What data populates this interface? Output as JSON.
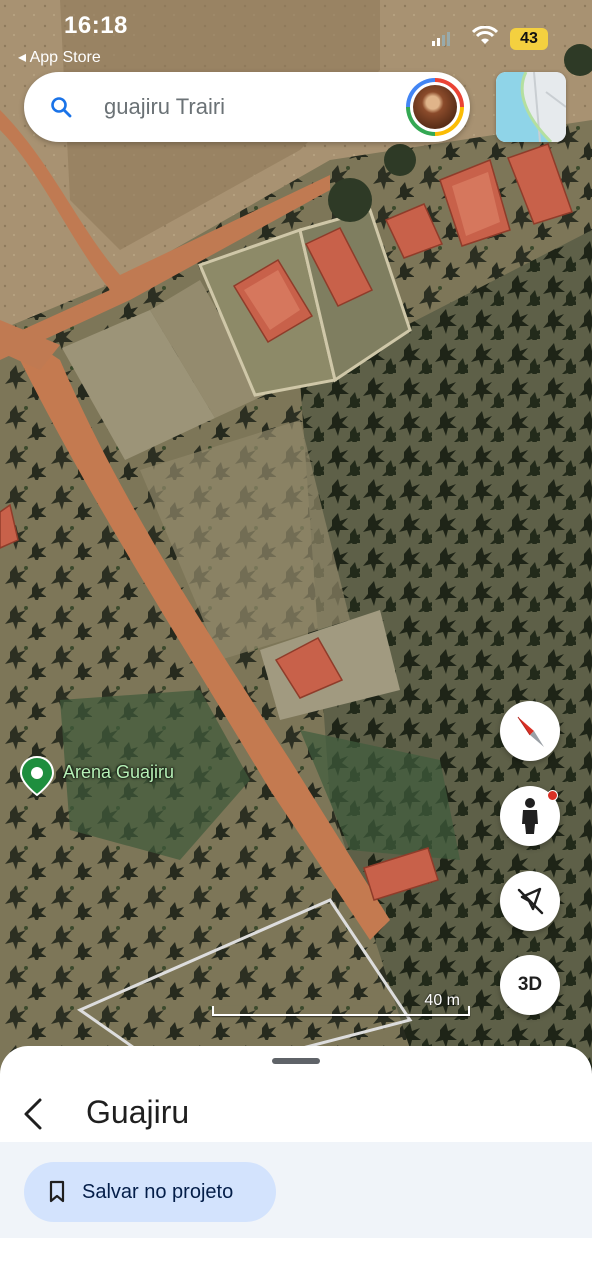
{
  "status_bar": {
    "time": "16:18",
    "back_app": "App Store",
    "battery": "43"
  },
  "search": {
    "query": "guajiru Trairi",
    "icon": "search-icon"
  },
  "map": {
    "type": "satellite",
    "place_marker_label": "Arena Guajiru",
    "scale_label": "40 m"
  },
  "controls": {
    "compass_icon": "compass-icon",
    "street_view_icon": "pegman-icon",
    "location_icon": "location-off-icon",
    "view_3d_label": "3D"
  },
  "bottom_sheet": {
    "title": "Guajiru",
    "save_button_label": "Salvar no projeto"
  },
  "colors": {
    "accent": "#1a73e8",
    "save_button_bg": "#d3e3fd",
    "marker_green": "#1e8e3e",
    "compass_red": "#d93025"
  }
}
